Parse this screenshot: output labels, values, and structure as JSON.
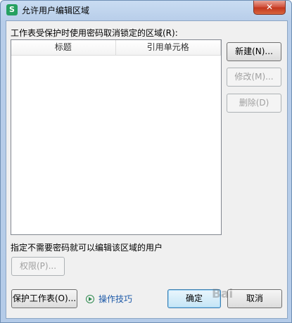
{
  "window": {
    "title": "允许用户编辑区域",
    "app_icon_letter": "S",
    "close_glyph": "✕"
  },
  "ranges": {
    "label": "工作表受保护时使用密码取消锁定的区域(R):",
    "columns": [
      "标题",
      "引用单元格"
    ],
    "rows": []
  },
  "buttons": {
    "new": "新建(N)...",
    "modify": "修改(M)...",
    "delete": "删除(D)",
    "permissions": "权限(P)...",
    "protect_sheet": "保护工作表(O)...",
    "ok": "确定",
    "cancel": "取消"
  },
  "users_label": "指定不需要密码就可以编辑该区域的用户",
  "tips_link": "操作技巧",
  "watermark": "Bai"
}
